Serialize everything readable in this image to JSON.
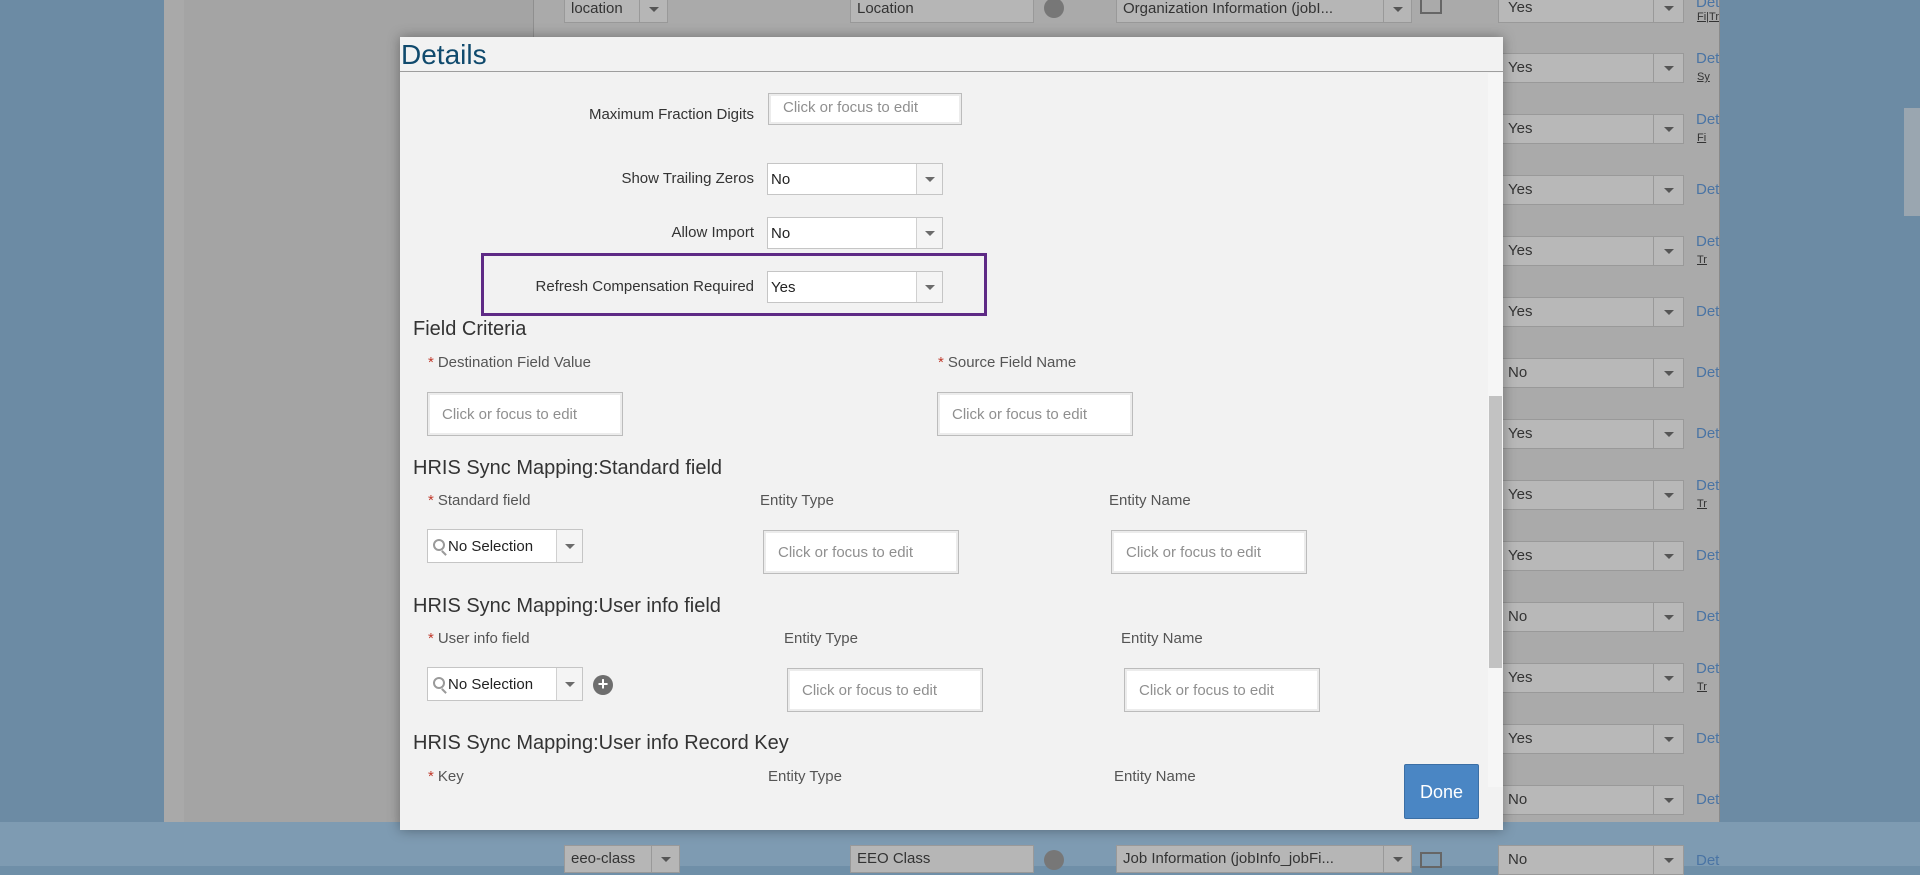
{
  "background": {
    "rows": [
      {
        "value": "Yes",
        "link": "Det",
        "sub": "Fi|Tr"
      },
      {
        "value": "Yes",
        "link": "Det",
        "sub": "Sy"
      },
      {
        "value": "Yes",
        "link": "Det",
        "sub": "Fi"
      },
      {
        "value": "Yes",
        "link": "Det",
        "sub": ""
      },
      {
        "value": "Yes",
        "link": "Det",
        "sub": "Tr"
      },
      {
        "value": "Yes",
        "link": "Det",
        "sub": ""
      },
      {
        "value": "No",
        "link": "Det",
        "sub": ""
      },
      {
        "value": "Yes",
        "link": "Det",
        "sub": ""
      },
      {
        "value": "Yes",
        "link": "Det",
        "sub": "Tr"
      },
      {
        "value": "Yes",
        "link": "Det",
        "sub": ""
      },
      {
        "value": "No",
        "link": "Det",
        "sub": ""
      },
      {
        "value": "Yes",
        "link": "Det",
        "sub": "Tr"
      },
      {
        "value": "Yes",
        "link": "Det",
        "sub": ""
      },
      {
        "value": "No",
        "link": "Det",
        "sub": ""
      },
      {
        "value": "No",
        "link": "Det",
        "sub": ""
      }
    ],
    "top_row": {
      "id": "location",
      "label": "Location",
      "source": "Organization Information (jobI..."
    },
    "bottom_row": {
      "id": "eeo-class",
      "label": "EEO Class",
      "source": "Job Information (jobInfo_jobFi..."
    }
  },
  "modal": {
    "title": "Details",
    "placeholder": "Click or focus to edit",
    "max_fraction_label": "Maximum Fraction Digits",
    "show_trailing_zeros_label": "Show Trailing Zeros",
    "show_trailing_zeros_value": "No",
    "allow_import_label": "Allow Import",
    "allow_import_value": "No",
    "refresh_comp_label": "Refresh Compensation Required",
    "refresh_comp_value": "Yes",
    "field_criteria": {
      "title": "Field Criteria",
      "dest_label": "Destination Field Value",
      "source_label": "Source Field Name"
    },
    "std_field": {
      "title": "HRIS Sync Mapping:Standard field",
      "field_label": "Standard field",
      "field_value": "No Selection",
      "entity_type_label": "Entity Type",
      "entity_name_label": "Entity Name"
    },
    "user_info": {
      "title": "HRIS Sync Mapping:User info field",
      "field_label": "User info field",
      "field_value": "No Selection",
      "entity_type_label": "Entity Type",
      "entity_name_label": "Entity Name",
      "add_symbol": "+"
    },
    "record_key": {
      "title": "HRIS Sync Mapping:User info Record Key",
      "key_label": "Key",
      "entity_type_label": "Entity Type",
      "entity_name_label": "Entity Name"
    },
    "required_mark": "*",
    "done_label": "Done"
  }
}
